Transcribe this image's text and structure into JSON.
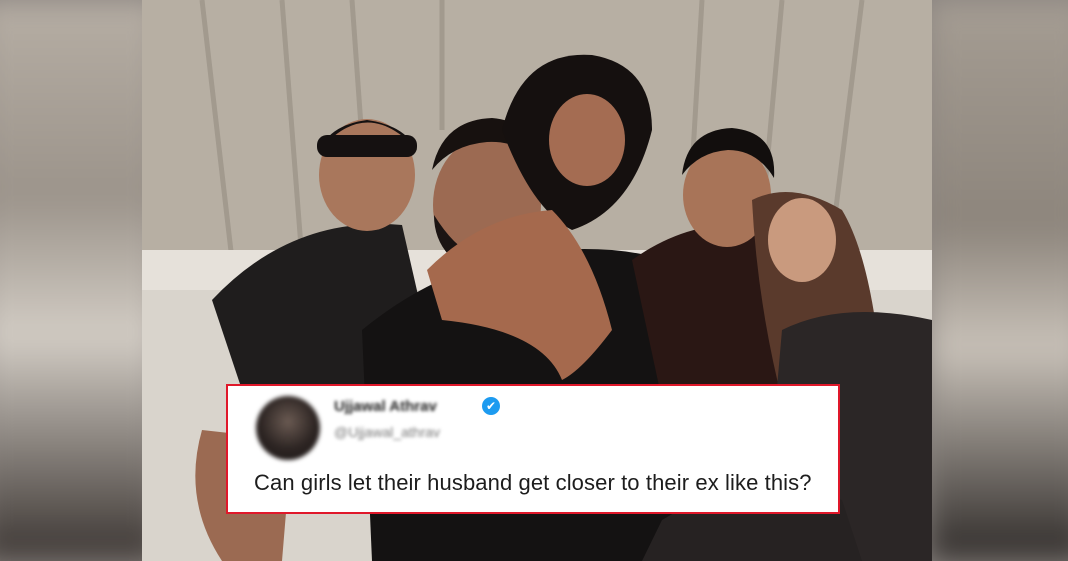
{
  "tweet": {
    "author_name": "Ujjawal Athrav",
    "author_handle": "@Ujjawal_athrav",
    "verified_icon": "✔",
    "text": "Can girls let their husband get closer to their ex like this?"
  },
  "colors": {
    "card_border": "#e0182a",
    "verified_badge": "#1d9bf0",
    "card_background": "#ffffff"
  },
  "icons": [
    "verified-badge-icon",
    "avatar"
  ]
}
